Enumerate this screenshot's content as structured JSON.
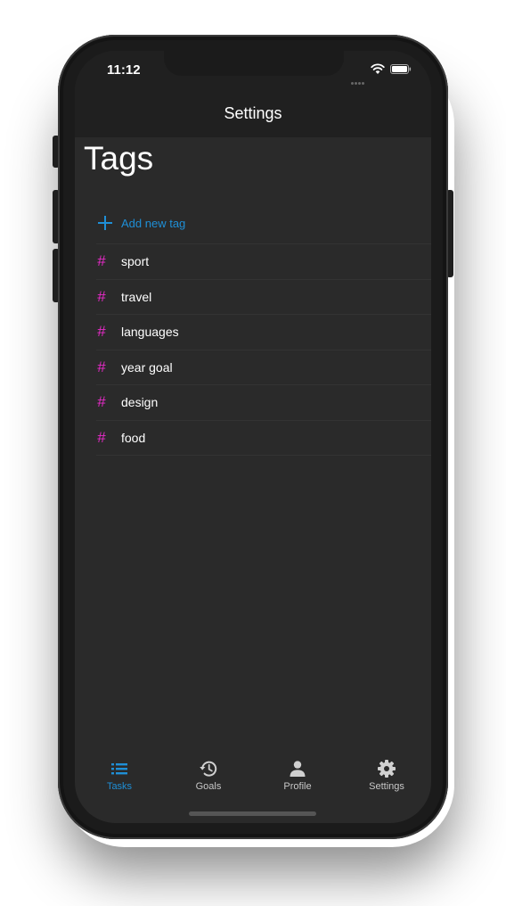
{
  "status_bar": {
    "time": "11:12",
    "icons": [
      "signal-dots-icon",
      "wifi-icon",
      "battery-icon"
    ]
  },
  "nav": {
    "title": "Settings"
  },
  "page": {
    "title": "Tags"
  },
  "add_tag": {
    "icon": "plus-icon",
    "label": "Add new tag"
  },
  "tags": [
    {
      "label": "sport"
    },
    {
      "label": "travel"
    },
    {
      "label": "languages"
    },
    {
      "label": "year goal"
    },
    {
      "label": "design"
    },
    {
      "label": "food"
    }
  ],
  "tabbar": {
    "tabs": [
      {
        "label": "Tasks",
        "icon": "list-icon",
        "active": true
      },
      {
        "label": "Goals",
        "icon": "history-icon",
        "active": false
      },
      {
        "label": "Profile",
        "icon": "person-icon",
        "active": false
      },
      {
        "label": "Settings",
        "icon": "gear-icon",
        "active": false
      }
    ]
  },
  "colors": {
    "accent": "#1f8fd6",
    "hash": "#e72ac8",
    "background": "#2a2a2a",
    "header": "#202020"
  }
}
